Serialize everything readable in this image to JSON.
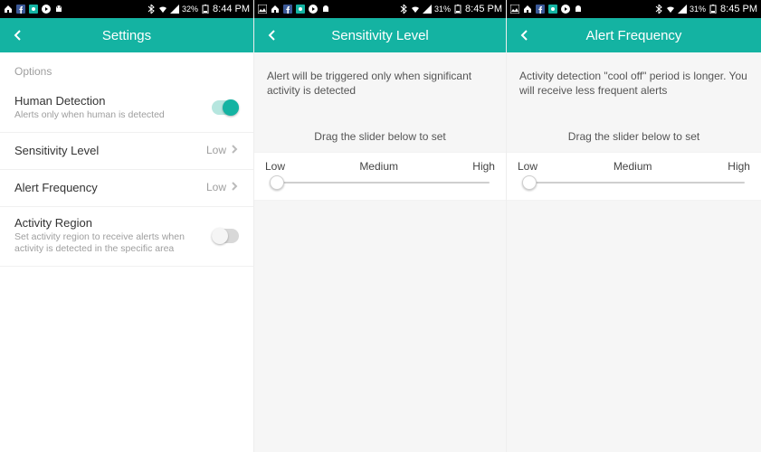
{
  "panes": [
    {
      "status": {
        "battery_pct": "32%",
        "clock": "8:44 PM"
      },
      "header": {
        "title": "Settings"
      },
      "section_label": "Options",
      "items": [
        {
          "title": "Human Detection",
          "sub": "Alerts only when human is detected",
          "toggle_on": true
        },
        {
          "title": "Sensitivity Level",
          "value": "Low"
        },
        {
          "title": "Alert Frequency",
          "value": "Low"
        },
        {
          "title": "Activity Region",
          "sub": "Set activity region to receive alerts when activity is detected in the specific area",
          "toggle_on": false
        }
      ]
    },
    {
      "status": {
        "battery_pct": "31%",
        "clock": "8:45 PM"
      },
      "header": {
        "title": "Sensitivity Level"
      },
      "desc": "Alert will be triggered only when significant activity is detected",
      "drag_label": "Drag the slider below to set",
      "slider": {
        "labels": [
          "Low",
          "Medium",
          "High"
        ],
        "value_pct": 3
      }
    },
    {
      "status": {
        "battery_pct": "31%",
        "clock": "8:45 PM"
      },
      "header": {
        "title": "Alert Frequency"
      },
      "desc": "Activity detection \"cool off\" period is longer. You will receive less frequent alerts",
      "drag_label": "Drag the slider below to set",
      "slider": {
        "labels": [
          "Low",
          "Medium",
          "High"
        ],
        "value_pct": 3
      }
    }
  ],
  "icons": {
    "home": "home",
    "fb": "fb",
    "cam": "cam",
    "play": "play",
    "droid": "droid",
    "pic": "pic",
    "bt": "bt",
    "wifi": "wifi",
    "sig": "sig",
    "batt": "batt"
  }
}
